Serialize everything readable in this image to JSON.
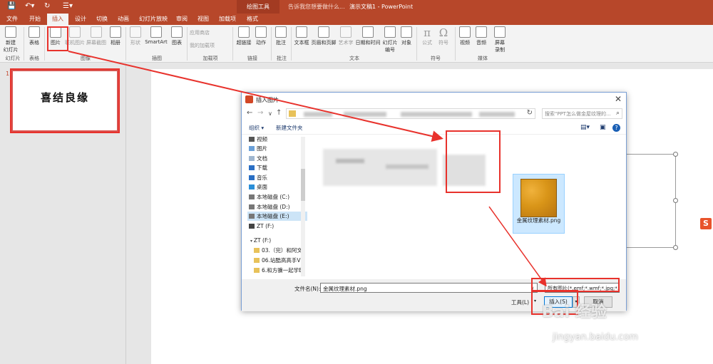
{
  "titlebar": {
    "save_icon": "save-icon",
    "undo_icon": "undo-icon",
    "redo_icon": "redo-icon",
    "context_tab": "绘图工具",
    "tell_me": "告诉我您想要做什么...",
    "window_title": "演示文稿1 - PowerPoint"
  },
  "tabs": [
    "文件",
    "开始",
    "插入",
    "设计",
    "切换",
    "动画",
    "幻灯片放映",
    "审阅",
    "视图",
    "加载项",
    "格式"
  ],
  "active_tab": "插入",
  "ribbon": {
    "buttons": {
      "new_slide": "新建\n幻灯片",
      "table": "表格",
      "picture": "图片",
      "online_picture": "联机图片",
      "screenshot": "屏幕截图",
      "album": "相册",
      "shapes": "形状",
      "smartart": "SmartArt",
      "chart": "图表",
      "store": "应用商店",
      "my_addins": "我的加载项",
      "hyperlink": "超链接",
      "action": "动作",
      "comment": "批注",
      "textbox": "文本框",
      "header_footer": "页眉和页脚",
      "wordart": "艺术字",
      "datetime": "日期和时间",
      "slide_number": "幻灯片\n编号",
      "object": "对象",
      "equation": "公式",
      "symbol": "符号",
      "video": "视频",
      "audio": "音频",
      "screen_record": "屏幕\n录制"
    },
    "groups": {
      "slides": "幻灯片",
      "tables": "表格",
      "images": "图像",
      "illustrations": "插图",
      "addins": "加载项",
      "links": "链接",
      "comments": "批注",
      "text": "文本",
      "symbols": "符号",
      "media": "媒体"
    }
  },
  "slide_panel": {
    "number": "1",
    "thumb_text": "喜结良缘"
  },
  "dialog": {
    "title": "插入图片",
    "close": "✕",
    "search_placeholder": "搜索\"PPT怎么做金屋纹理的...",
    "organize": "组织 ▾",
    "new_folder": "新建文件夹",
    "nav_items": [
      {
        "label": "视频",
        "icon": "video-folder-icon"
      },
      {
        "label": "图片",
        "icon": "pictures-folder-icon"
      },
      {
        "label": "文档",
        "icon": "documents-folder-icon"
      },
      {
        "label": "下载",
        "icon": "download-folder-icon"
      },
      {
        "label": "音乐",
        "icon": "music-folder-icon"
      },
      {
        "label": "桌面",
        "icon": "desktop-folder-icon"
      },
      {
        "label": "本地磁盘 (C:)",
        "icon": "drive-icon"
      },
      {
        "label": "本地磁盘 (D:)",
        "icon": "drive-icon"
      },
      {
        "label": "本地磁盘 (E:)",
        "icon": "drive-icon"
      },
      {
        "label": "ZT (F:)",
        "icon": "usb-drive-icon"
      },
      {
        "label": "",
        "icon": ""
      },
      {
        "label": "ZT (F:)",
        "icon": "usb-drive-icon"
      },
      {
        "label": "03.（完）和阿文",
        "icon": "folder-icon"
      },
      {
        "label": "06.站酷高高手V",
        "icon": "folder-icon"
      },
      {
        "label": "6.和方骥一起学E",
        "icon": "folder-icon"
      }
    ],
    "selected_nav": "本地磁盘 (E:)",
    "file_name": "金属纹理素材.png",
    "filename_label": "文件名(N):",
    "filename_value": "金属纹理素材.png",
    "file_type": "所有图片(*.emf;*.wmf;*.jpg;*.jp",
    "tools": "工具(L)",
    "insert": "插入(S)",
    "cancel": "取消"
  },
  "watermark": {
    "line1": "Bai 经验",
    "line2": "jingyan.baidu.com"
  }
}
